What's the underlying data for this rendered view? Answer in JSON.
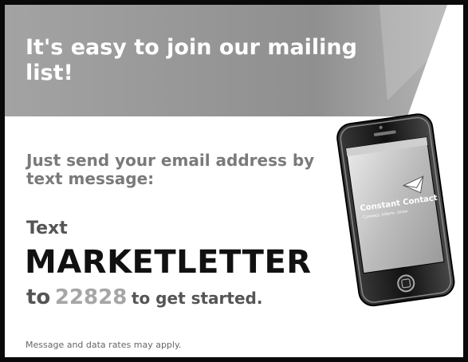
{
  "banner": {
    "headline": "It's easy to join our mailing list!"
  },
  "body": {
    "instruction": "Just send your email address by text message:",
    "text_label": "Text",
    "keyword": "MARKETLETTER",
    "to_label": "to",
    "short_code": "22828",
    "get_started": "to get started."
  },
  "phone": {
    "brand_name": "Constant Contact",
    "brand_tagline": "Connect. Inform. Grow."
  },
  "footer": {
    "disclaimer": "Message and data rates may apply."
  },
  "colors": {
    "banner": "#9a9a9a",
    "keyword": "#111111",
    "short_code": "#a6a6a6"
  }
}
